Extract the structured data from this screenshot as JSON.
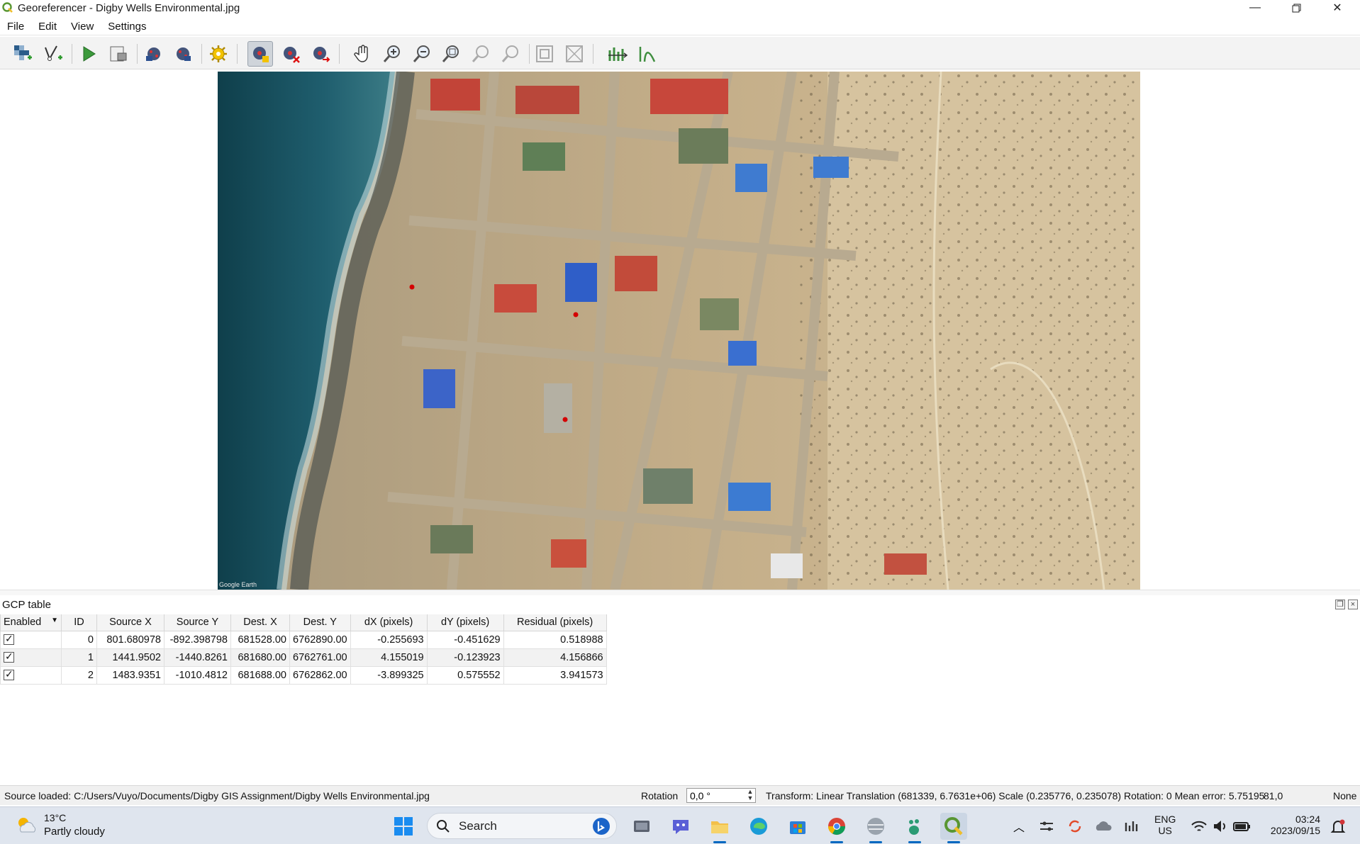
{
  "window": {
    "title": "Georeferencer - Digby Wells Environmental.jpg"
  },
  "menu": {
    "items": [
      "File",
      "Edit",
      "View",
      "Settings"
    ]
  },
  "toolbar": {
    "tools": [
      "open-raster-icon",
      "add-vector-icon",
      "start-georeferencing-icon",
      "generate-gdal-script-icon",
      "load-gcp-icon",
      "save-gcp-icon",
      "transformation-settings-icon",
      "add-point-icon",
      "delete-point-icon",
      "move-gcp-icon",
      "pan-icon",
      "zoom-in-icon",
      "zoom-out-icon",
      "zoom-to-layer-icon",
      "zoom-last-icon",
      "zoom-next-icon",
      "link-georeferencer-icon",
      "link-qgis-icon",
      "full-histogram-stretch-icon",
      "local-histogram-stretch-icon"
    ]
  },
  "map": {
    "watermark": "Google Earth"
  },
  "gcp_panel": {
    "title": "GCP table",
    "columns": [
      "Enabled",
      "ID",
      "Source X",
      "Source Y",
      "Dest. X",
      "Dest. Y",
      "dX (pixels)",
      "dY (pixels)",
      "Residual (pixels)"
    ],
    "rows": [
      {
        "enabled": true,
        "id": "0",
        "source_x": "801.680978",
        "source_y": "-892.398798",
        "dest_x": "681528.00",
        "dest_y": "6762890.00",
        "dx": "-0.255693",
        "dy": "-0.451629",
        "residual": "0.518988"
      },
      {
        "enabled": true,
        "id": "1",
        "source_x": "1441.9502",
        "source_y": "-1440.8261",
        "dest_x": "681680.00",
        "dest_y": "6762761.00",
        "dx": "4.155019",
        "dy": "-0.123923",
        "residual": "4.156866"
      },
      {
        "enabled": true,
        "id": "2",
        "source_x": "1483.9351",
        "source_y": "-1010.4812",
        "dest_x": "681688.00",
        "dest_y": "6762862.00",
        "dx": "-3.899325",
        "dy": "0.575552",
        "residual": "3.941573"
      }
    ]
  },
  "status": {
    "source": "Source loaded: C:/Users/Vuyo/Documents/Digby GIS Assignment/Digby Wells Environmental.jpg",
    "rotation_label": "Rotation",
    "rotation_value": "0,0 °",
    "transform": "Transform: Linear Translation (681339, 6.7631e+06) Scale (0.235776, 0.235078) Rotation: 0 Mean error: 5.75195",
    "coords": "81,0",
    "crs": "None"
  },
  "taskbar": {
    "weather_temp": "13°C",
    "weather_cond": "Partly cloudy",
    "search_label": "Search",
    "lang_top": "ENG",
    "lang_bottom": "US",
    "time": "03:24",
    "date": "2023/09/15"
  },
  "colors": {
    "accent": "#0067c0",
    "gcp_point": "#d40000",
    "ocean": "#1f5e6e",
    "sand": "#cdb48a"
  }
}
